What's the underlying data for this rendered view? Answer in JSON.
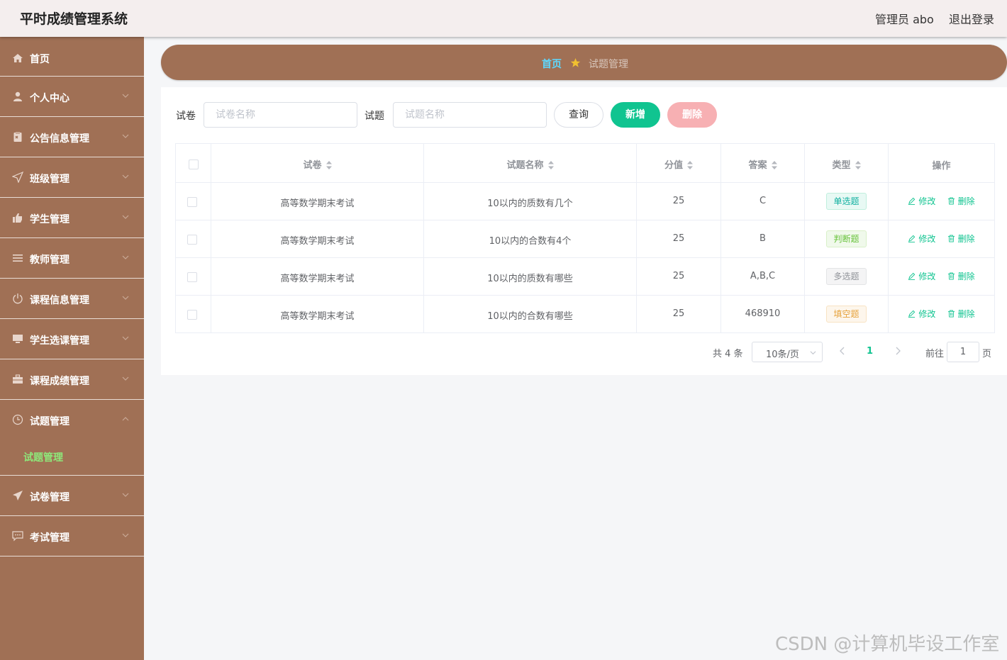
{
  "header": {
    "app_title": "平时成绩管理系统",
    "user_label": "管理员 abo",
    "logout_label": "退出登录"
  },
  "sidebar": {
    "items": [
      {
        "label": "首页",
        "icon": "home-icon"
      },
      {
        "label": "个人中心",
        "icon": "user-icon"
      },
      {
        "label": "公告信息管理",
        "icon": "clipboard-icon"
      },
      {
        "label": "班级管理",
        "icon": "send-icon"
      },
      {
        "label": "学生管理",
        "icon": "thumb-icon"
      },
      {
        "label": "教师管理",
        "icon": "menu-icon"
      },
      {
        "label": "课程信息管理",
        "icon": "power-icon"
      },
      {
        "label": "学生选课管理",
        "icon": "monitor-icon"
      },
      {
        "label": "课程成绩管理",
        "icon": "briefcase-icon"
      },
      {
        "label": "试题管理",
        "icon": "clock-icon"
      },
      {
        "label": "试卷管理",
        "icon": "paper-plane-icon"
      },
      {
        "label": "考试管理",
        "icon": "chat-icon"
      }
    ],
    "open_submenu": {
      "label": "试题管理"
    }
  },
  "breadcrumb": {
    "home": "首页",
    "current": "试题管理"
  },
  "search": {
    "paper_label": "试卷",
    "paper_placeholder": "试卷名称",
    "question_label": "试题",
    "question_placeholder": "试题名称",
    "query_button": "查询",
    "add_button": "新增",
    "delete_button": "删除"
  },
  "table": {
    "headers": {
      "paper": "试卷",
      "question": "试题名称",
      "score": "分值",
      "answer": "答案",
      "type": "类型",
      "actions": "操作"
    },
    "rows": [
      {
        "paper": "高等数学期末考试",
        "question": "10以内的质数有几个",
        "score": "25",
        "answer": "C",
        "type": "单选题",
        "edit": "修改",
        "delete": "删除"
      },
      {
        "paper": "高等数学期末考试",
        "question": "10以内的合数有4个",
        "score": "25",
        "answer": "B",
        "type": "判断题",
        "edit": "修改",
        "delete": "删除"
      },
      {
        "paper": "高等数学期末考试",
        "question": "10以内的质数有哪些",
        "score": "25",
        "answer": "A,B,C",
        "type": "多选题",
        "edit": "修改",
        "delete": "删除"
      },
      {
        "paper": "高等数学期末考试",
        "question": "10以内的合数有哪些",
        "score": "25",
        "answer": "468910",
        "type": "填空题",
        "edit": "修改",
        "delete": "删除"
      }
    ]
  },
  "pagination": {
    "total": "共 4 条",
    "page_size": "10条/页",
    "current_page": "1",
    "goto_label": "前往",
    "goto_value": "1",
    "page_suffix": "页"
  },
  "watermark": "CSDN @计算机毕设工作室",
  "colors": {
    "sidebar_bg": "#a07055",
    "accent_green": "#10c490",
    "delete_disabled": "#f7b0b3",
    "breadcrumb_home": "#5ed8ff",
    "active_submenu": "#8ee87a"
  }
}
